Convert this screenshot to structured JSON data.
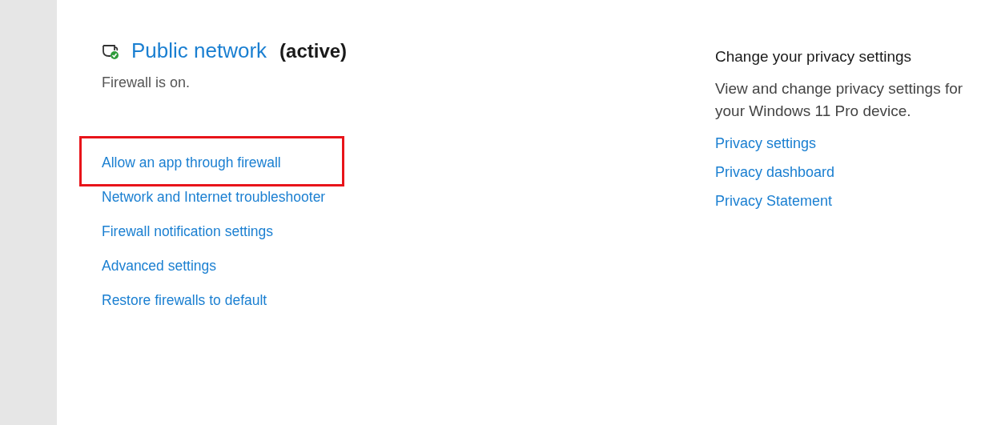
{
  "network": {
    "name": "Public network",
    "status": "(active)",
    "firewall_state": "Firewall is on."
  },
  "links": [
    {
      "label": "Allow an app through firewall",
      "highlighted": true
    },
    {
      "label": "Network and Internet troubleshooter",
      "highlighted": false
    },
    {
      "label": "Firewall notification settings",
      "highlighted": false
    },
    {
      "label": "Advanced settings",
      "highlighted": false
    },
    {
      "label": "Restore firewalls to default",
      "highlighted": false
    }
  ],
  "privacy": {
    "heading": "Change your privacy settings",
    "description": "View and change privacy settings for your Windows 11 Pro device.",
    "links": [
      "Privacy settings",
      "Privacy dashboard",
      "Privacy Statement"
    ]
  }
}
